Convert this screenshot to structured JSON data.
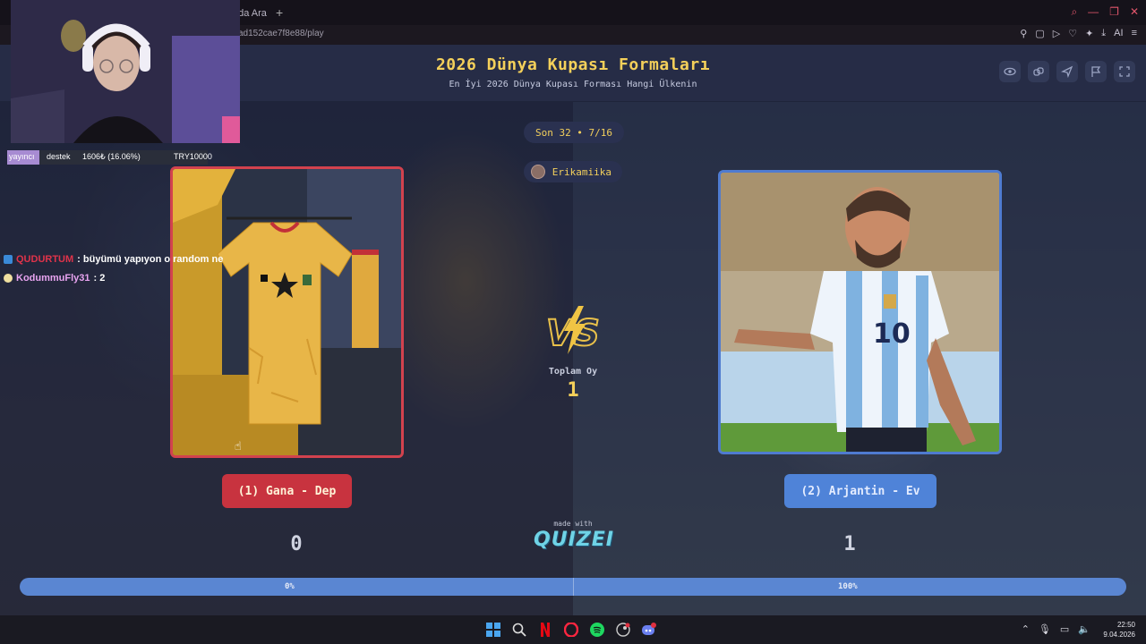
{
  "browser": {
    "tab_fragment": "'da Ara",
    "new_tab": "+",
    "url_fragment": "ad152cae7f8e88/play",
    "ai_label": "AI"
  },
  "quiz": {
    "title": "2026 Dünya Kupası Formaları",
    "subtitle": "En İyi 2026 Dünya Kupası Forması Hangi Ülkenin",
    "round": "Son 32 • 7/16",
    "creator": "Erikamiika",
    "header_buttons": [
      "eye-icon",
      "link-icon",
      "send-icon",
      "flag-icon",
      "fullscreen-icon"
    ],
    "vs_label": "VS",
    "total_votes_label": "Toplam Oy",
    "total_votes": "1",
    "made_with": "made with",
    "brand": "QUIZEI",
    "left": {
      "label": "(1) Gana - Dep",
      "votes": "0",
      "percent_label": "0%",
      "percent": 0,
      "image": "ghana-jersey-photo"
    },
    "right": {
      "label": "(2) Arjantin - Ev",
      "votes": "1",
      "percent_label": "100%",
      "percent": 100,
      "image": "argentina-player-photo"
    },
    "colors": {
      "left_accent": "#c8333f",
      "right_accent": "#4f83d8",
      "title": "#f4d05a"
    }
  },
  "overlay": {
    "support_bar": {
      "label_a": "yayıncı",
      "label_b": "destek",
      "amount": "1606₺ (16.06%)",
      "goal": "TRY10000",
      "fill": 0.1606
    },
    "chat": [
      {
        "user": "QUDURTUM",
        "message": ": büyümü yapıyon o random ne"
      },
      {
        "user": "KodummuFly31",
        "message": ": 2"
      }
    ]
  },
  "taskbar": {
    "icons": [
      "windows-icon",
      "search-icon",
      "netflix-icon",
      "opera-icon",
      "spotify-icon",
      "steam-icon",
      "discord-icon"
    ],
    "time": "22:50",
    "date": "9.04.2026"
  }
}
